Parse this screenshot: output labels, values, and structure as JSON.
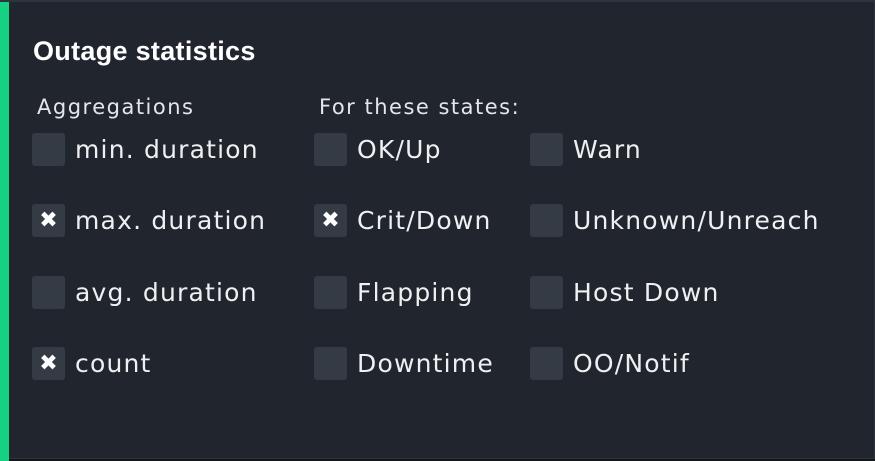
{
  "panel": {
    "title": "Outage statistics",
    "accent_color": "#15d181"
  },
  "aggregations": {
    "label": "Aggregations",
    "items": [
      {
        "label": "min. duration",
        "checked": false
      },
      {
        "label": "max. duration",
        "checked": true
      },
      {
        "label": "avg. duration",
        "checked": false
      },
      {
        "label": "count",
        "checked": true
      }
    ]
  },
  "states": {
    "label": "For these states:",
    "items": [
      {
        "label": "OK/Up",
        "checked": false
      },
      {
        "label": "Warn",
        "checked": false
      },
      {
        "label": "Crit/Down",
        "checked": true
      },
      {
        "label": "Unknown/Unreach",
        "checked": false
      },
      {
        "label": "Flapping",
        "checked": false
      },
      {
        "label": "Host Down",
        "checked": false
      },
      {
        "label": "Downtime",
        "checked": false
      },
      {
        "label": "OO/Notif",
        "checked": false
      }
    ]
  },
  "icons": {
    "check_mark": "✖",
    "check_mark_name": "x-mark-icon"
  }
}
